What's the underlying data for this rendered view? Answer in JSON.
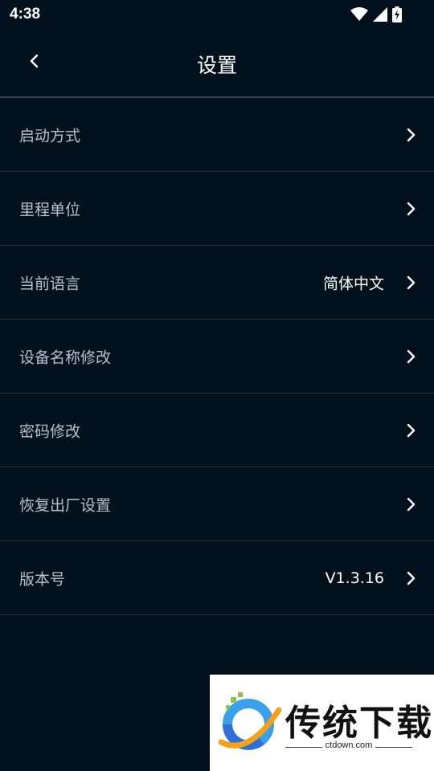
{
  "status_bar": {
    "time": "4:38",
    "icons": [
      "wifi-icon",
      "signal-icon",
      "battery-charging-icon"
    ]
  },
  "header": {
    "back_icon": "chevron-left-icon",
    "title": "设置"
  },
  "settings": {
    "items": [
      {
        "label": "启动方式",
        "value": ""
      },
      {
        "label": "里程单位",
        "value": ""
      },
      {
        "label": "当前语言",
        "value": "简体中文"
      },
      {
        "label": "设备名称修改",
        "value": ""
      },
      {
        "label": "密码修改",
        "value": ""
      },
      {
        "label": "恢复出厂设置",
        "value": ""
      },
      {
        "label": "版本号",
        "value": "V1.3.16"
      }
    ]
  },
  "watermark": {
    "text": "传统下载",
    "url": "ctdown.com"
  },
  "colors": {
    "background": "#03111f",
    "label": "#b9c0c7",
    "value": "#ffffff",
    "divider": "#26313c"
  }
}
